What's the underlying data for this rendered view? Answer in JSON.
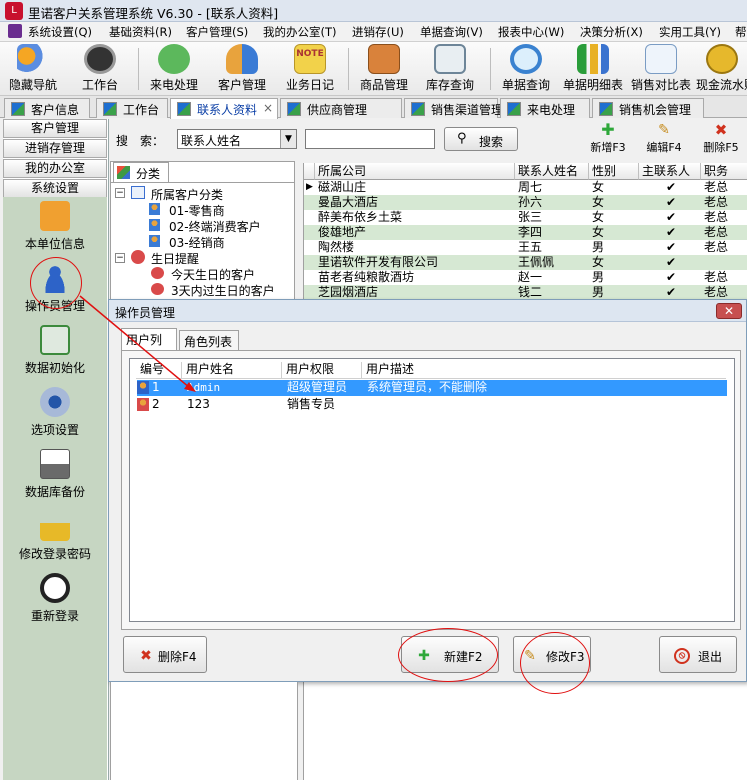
{
  "window": {
    "title": "里诺客户关系管理系统 V6.30 - [联系人资料]"
  },
  "menu": [
    "系统设置(Q)",
    "基础资料(R)",
    "客户管理(S)",
    "我的办公室(T)",
    "进销存(U)",
    "单据查询(V)",
    "报表中心(W)",
    "决策分析(X)",
    "实用工具(Y)",
    "帮"
  ],
  "toolbar": [
    {
      "label": "隐藏导航",
      "icon": "hide-nav-icon"
    },
    {
      "label": "工作台",
      "icon": "clock-icon"
    },
    {
      "label": "来电处理",
      "icon": "phone-icon"
    },
    {
      "label": "客户管理",
      "icon": "customer-icon"
    },
    {
      "label": "业务日记",
      "icon": "note-icon"
    },
    {
      "label": "商品管理",
      "icon": "goods-icon"
    },
    {
      "label": "库存查询",
      "icon": "inventory-icon"
    },
    {
      "label": "单据查询",
      "icon": "magnifier-icon"
    },
    {
      "label": "单据明细表",
      "icon": "bar-chart-icon"
    },
    {
      "label": "销售对比表",
      "icon": "line-chart-icon"
    },
    {
      "label": "现金流水账",
      "icon": "coins-icon"
    }
  ],
  "note_icon_text": "NOTE",
  "tabs": [
    {
      "label": "客户信息",
      "active": false
    },
    {
      "label": "工作台",
      "active": false
    },
    {
      "label": "联系人资料",
      "active": true
    },
    {
      "label": "供应商管理",
      "active": false
    },
    {
      "label": "销售渠道管理",
      "active": false
    },
    {
      "label": "来电处理",
      "active": false
    },
    {
      "label": "销售机会管理",
      "active": false
    }
  ],
  "tab_close": "×",
  "leftnav": {
    "sections": [
      "客户管理",
      "进销存管理",
      "我的办公室",
      "系统设置"
    ],
    "items": [
      {
        "label": "本单位信息",
        "icon": "company-info-icon"
      },
      {
        "label": "操作员管理",
        "icon": "operator-icon"
      },
      {
        "label": "数据初始化",
        "icon": "recycle-icon"
      },
      {
        "label": "选项设置",
        "icon": "options-icon"
      },
      {
        "label": "数据库备份",
        "icon": "backup-icon"
      },
      {
        "label": "修改登录密码",
        "icon": "lock-icon"
      },
      {
        "label": "重新登录",
        "icon": "relogin-icon"
      }
    ]
  },
  "search": {
    "label": "搜　索：",
    "field": "联系人姓名",
    "button": "搜索",
    "value": ""
  },
  "actions": {
    "add": "新增F3",
    "edit": "编辑F4",
    "delete": "删除F5"
  },
  "category": {
    "tab": "分类",
    "tree": [
      {
        "label": "所属客户分类",
        "level": 0,
        "toggle": "−"
      },
      {
        "label": "01-零售商",
        "level": 1
      },
      {
        "label": "02-终端消费客户",
        "level": 1
      },
      {
        "label": "03-经销商",
        "level": 1
      },
      {
        "label": "生日提醒",
        "level": 0,
        "toggle": "−"
      },
      {
        "label": "今天生日的客户",
        "level": 1
      },
      {
        "label": "3天内过生日的客户",
        "level": 1
      }
    ]
  },
  "grid": {
    "columns": [
      "所属公司",
      "联系人姓名",
      "性别",
      "主联系人",
      "职务"
    ],
    "rows": [
      [
        "磁湖山庄",
        "周七",
        "女",
        "✔",
        "老总"
      ],
      [
        "曼晶大酒店",
        "孙六",
        "女",
        "✔",
        "老总"
      ],
      [
        "醉美布依乡土菜",
        "张三",
        "女",
        "✔",
        "老总"
      ],
      [
        "俊雄地产",
        "李四",
        "女",
        "✔",
        "老总"
      ],
      [
        "陶然楼",
        "王五",
        "男",
        "✔",
        "老总"
      ],
      [
        "里诺软件开发有限公司",
        "王佩佩",
        "女",
        "✔",
        ""
      ],
      [
        "苗老者纯粮散酒坊",
        "赵一",
        "男",
        "✔",
        "老总"
      ],
      [
        "芝园烟酒店",
        "钱二",
        "男",
        "✔",
        "老总"
      ]
    ]
  },
  "dialog": {
    "title": "操作员管理",
    "close": "✕",
    "tabs": [
      "用户列表",
      "角色列表"
    ],
    "columns": [
      "编号",
      "用户姓名",
      "用户权限",
      "用户描述"
    ],
    "rows": [
      {
        "id": "1",
        "name": "Admin",
        "role": "超级管理员",
        "desc": "系统管理员，不能删除",
        "selected": true
      },
      {
        "id": "2",
        "name": "123",
        "role": "销售专员",
        "desc": "",
        "selected": false
      }
    ],
    "buttons": {
      "delete": "删除F4",
      "new": "新建F2",
      "edit": "修改F3",
      "exit": "退出"
    }
  },
  "colors": {
    "selection": "#3399ff",
    "annotation": "#e01010",
    "alt_row": "#d6e8d3",
    "sidebar": "#c6d6c2"
  }
}
